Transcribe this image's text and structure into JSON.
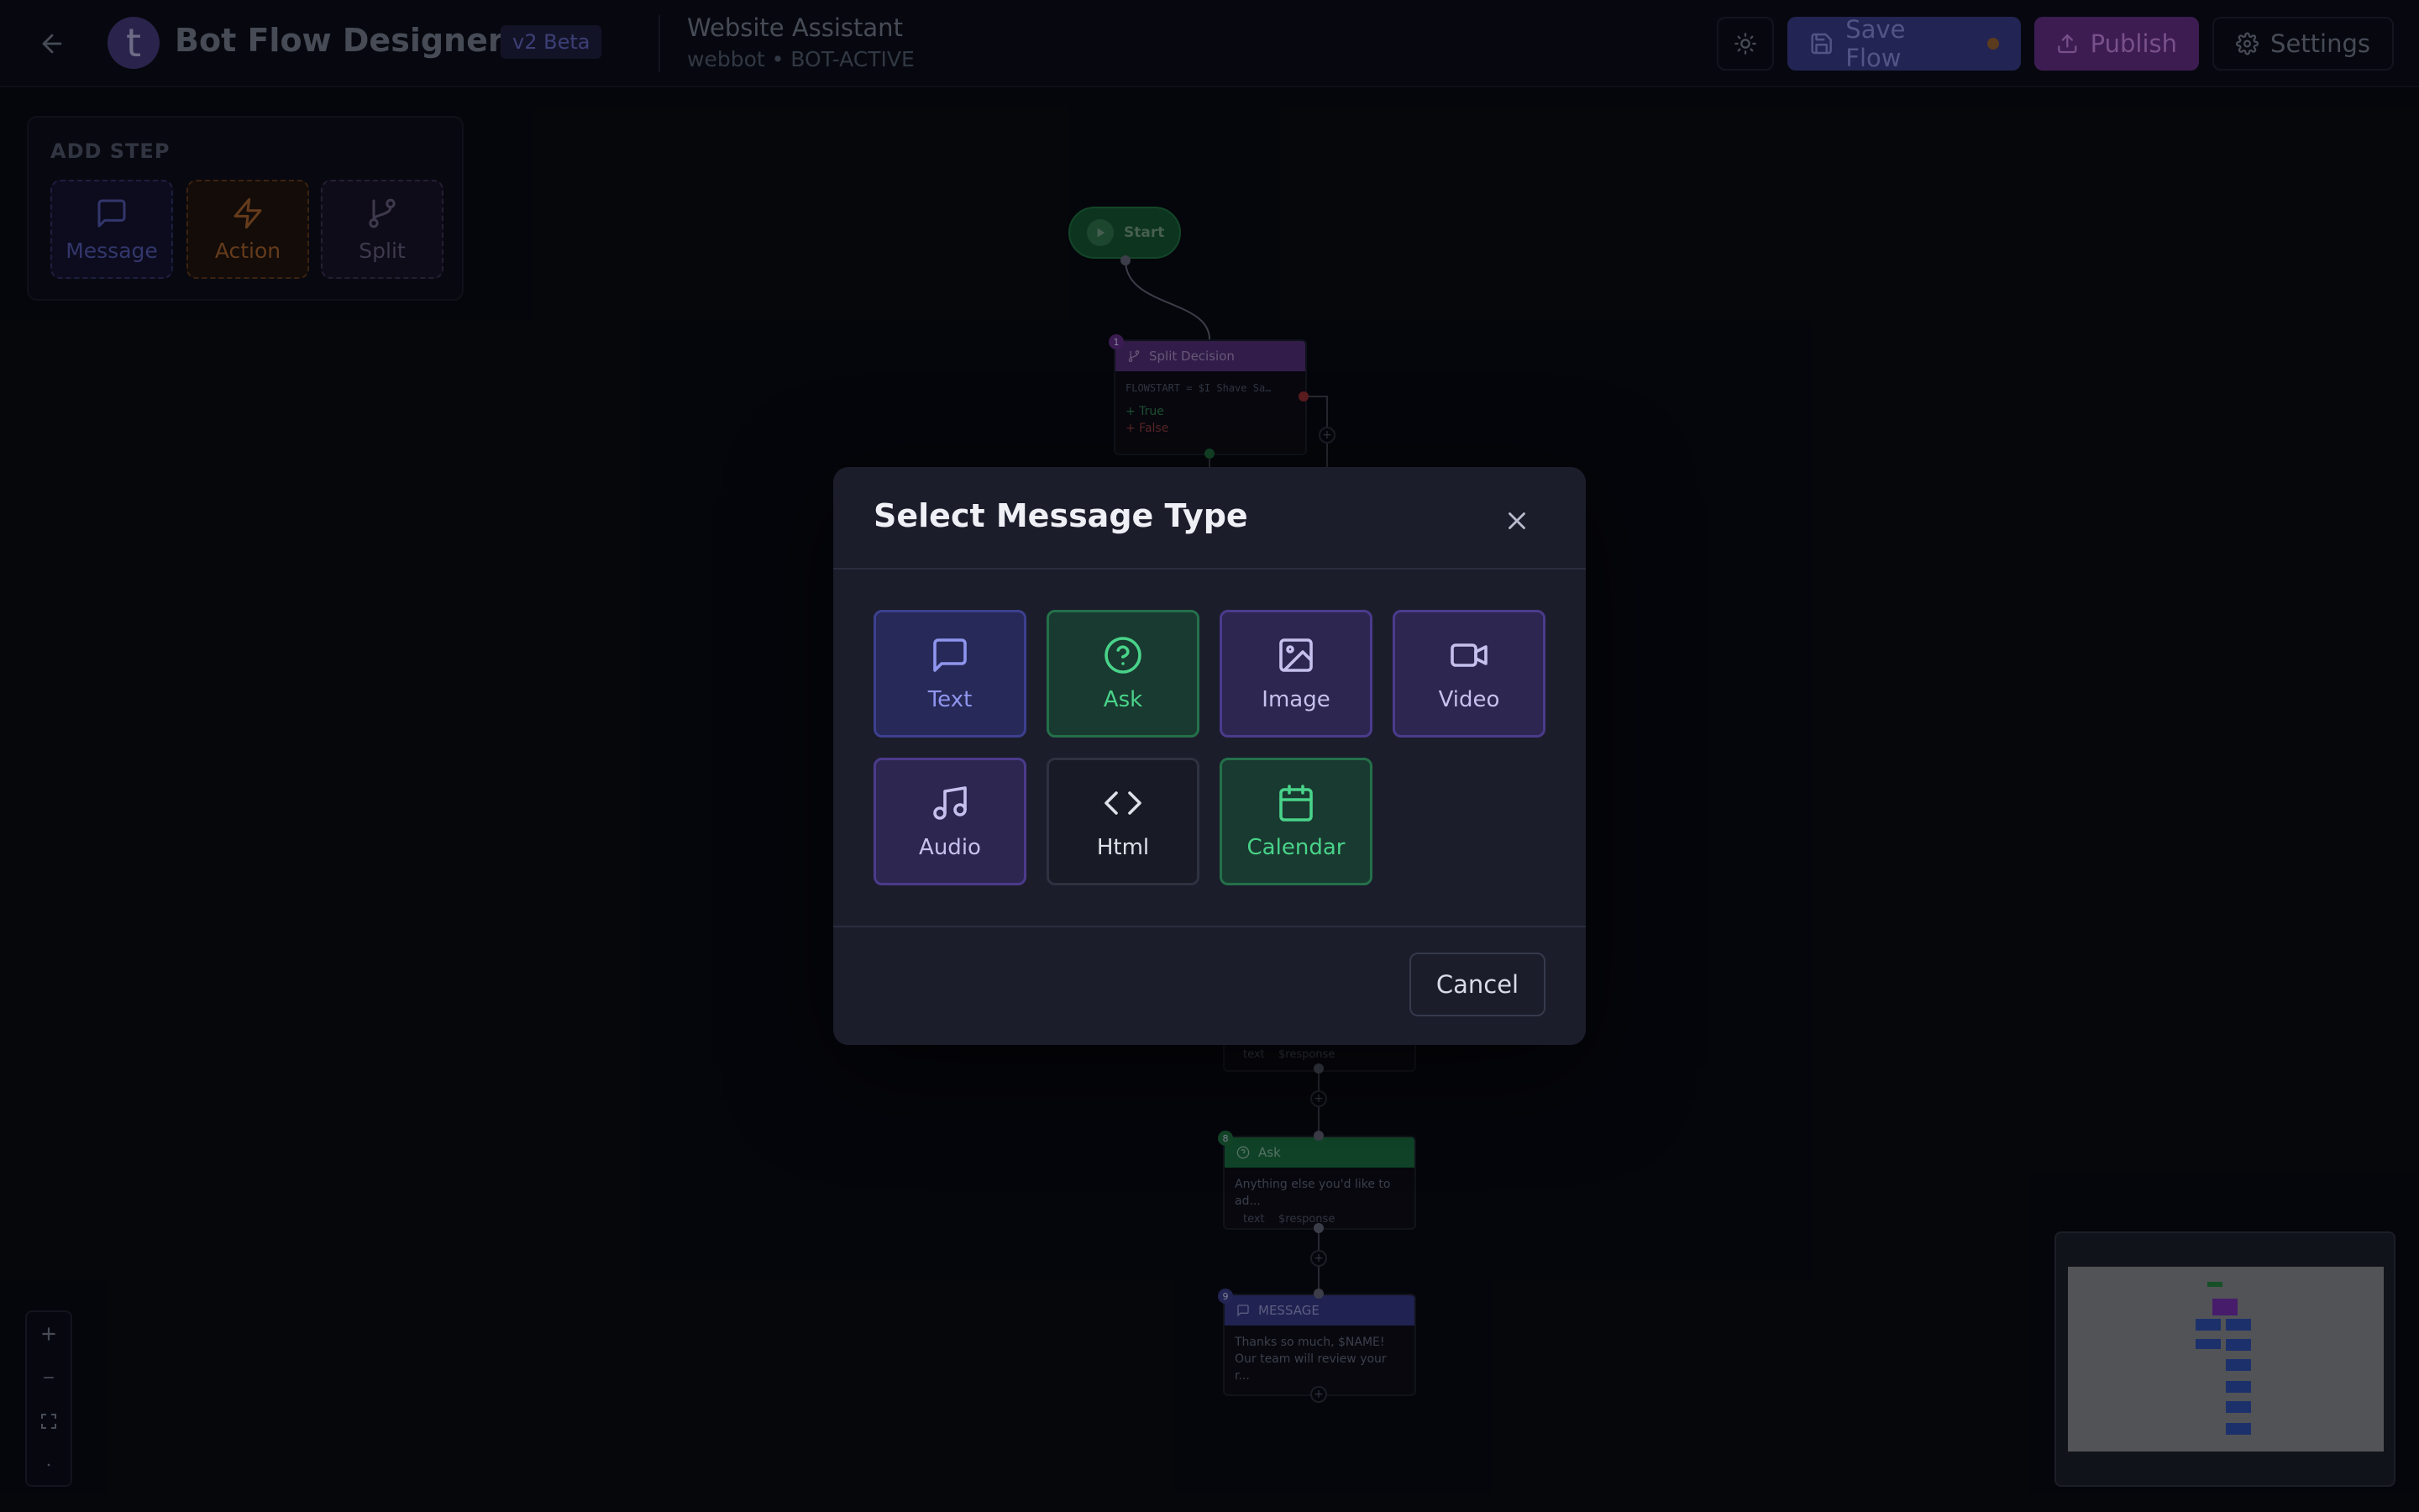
{
  "header": {
    "logo_letter": "t",
    "app_title": "Bot Flow Designer",
    "version_badge": "v2 Beta",
    "flow_name": "Website Assistant",
    "flow_subtitle": "webbot • BOT-ACTIVE",
    "save_label": "Save Flow",
    "publish_label": "Publish",
    "settings_label": "Settings"
  },
  "add_step": {
    "title": "ADD STEP",
    "items": [
      {
        "label": "Message",
        "icon": "message-icon"
      },
      {
        "label": "Action",
        "icon": "bolt-icon"
      },
      {
        "label": "Split",
        "icon": "branch-icon"
      }
    ]
  },
  "canvas": {
    "start_label": "Start",
    "split_node": {
      "number": "1",
      "title": "Split Decision",
      "condition": "FLOWSTART = $I Shave Sa…",
      "true_label": "+ True",
      "false_label": "+ False"
    },
    "partial_node": {
      "field_type": "text",
      "field_var": "$response"
    },
    "ask_node": {
      "number": "8",
      "title": "Ask",
      "body": "Anything else you'd like to ad...",
      "field_type": "text",
      "field_var": "$response"
    },
    "message_node": {
      "number": "9",
      "title": "MESSAGE",
      "body": "Thanks so much, $NAME! Our team will review your r..."
    }
  },
  "modal": {
    "title": "Select Message Type",
    "types": [
      {
        "label": "Text",
        "icon": "chat-bubble-icon"
      },
      {
        "label": "Ask",
        "icon": "question-circle-icon"
      },
      {
        "label": "Image",
        "icon": "image-icon"
      },
      {
        "label": "Video",
        "icon": "video-icon"
      },
      {
        "label": "Audio",
        "icon": "music-note-icon"
      },
      {
        "label": "Html",
        "icon": "code-icon"
      },
      {
        "label": "Calendar",
        "icon": "calendar-icon"
      }
    ],
    "cancel_label": "Cancel"
  },
  "colors": {
    "background": "#07080d",
    "modal": "#1b1d2b",
    "save_button": "#33367c",
    "publish_button": "#5d2a7a",
    "green_accent": "#49d38a",
    "purple_accent": "#8f95ee"
  }
}
